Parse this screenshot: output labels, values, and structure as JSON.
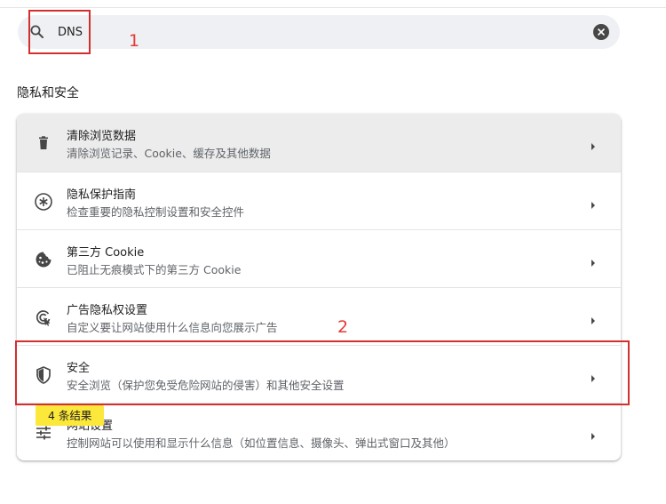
{
  "search": {
    "value": "DNS",
    "icon": "search-icon",
    "clear_icon": "clear-icon"
  },
  "annotations": {
    "label_1": "1",
    "label_2": "2",
    "color": "#d32f2f"
  },
  "section": {
    "title": "隐私和安全"
  },
  "items": [
    {
      "icon": "trash-icon",
      "title": "清除浏览数据",
      "subtitle": "清除浏览记录、Cookie、缓存及其他数据"
    },
    {
      "icon": "privacy-guide-icon",
      "title": "隐私保护指南",
      "subtitle": "检查重要的隐私控制设置和安全控件"
    },
    {
      "icon": "cookie-icon",
      "title": "第三方 Cookie",
      "subtitle": "已阻止无痕模式下的第三方 Cookie"
    },
    {
      "icon": "ad-privacy-icon",
      "title": "广告隐私权设置",
      "subtitle": "自定义要让网站使用什么信息向您展示广告"
    },
    {
      "icon": "shield-icon",
      "title": "安全",
      "subtitle": "安全浏览（保护您免受危险网站的侵害）和其他安全设置"
    },
    {
      "icon": "sliders-icon",
      "title": "网站设置",
      "subtitle": "控制网站可以使用和显示什么信息（如位置信息、摄像头、弹出式窗口及其他）"
    }
  ],
  "results_badge": "4 条结果",
  "colors": {
    "search_bg": "#eef0f3",
    "highlight": "#fce83a",
    "annotation": "#d32f2f"
  }
}
